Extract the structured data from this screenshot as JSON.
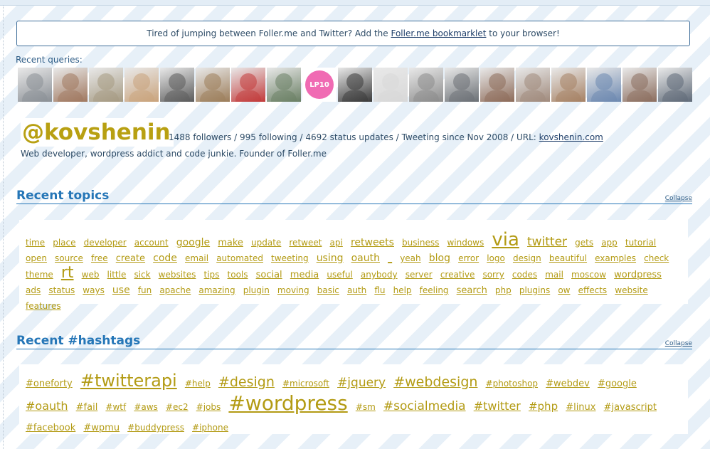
{
  "notice": {
    "before": "Tired of jumping between Foller.me and Twitter? Add the ",
    "link": "Foller.me bookmarklet",
    "after": " to your browser!"
  },
  "recent_queries_label": "Recent queries:",
  "profile": {
    "handle": "@kovshenin",
    "stats": "1488 followers / 995 following / 4692 status updates / Tweeting since Nov 2008 / URL: ",
    "url": "kovshenin.com",
    "bio": "Web developer, wordpress addict and code junkie. Founder of Foller.me"
  },
  "collapse_label": "Collapse",
  "topics_title": "Recent topics",
  "hashtags_title": "Recent #hashtags",
  "topics": [
    {
      "t": "time",
      "s": 12
    },
    {
      "t": "place",
      "s": 12
    },
    {
      "t": "developer",
      "s": 12
    },
    {
      "t": "account",
      "s": 12
    },
    {
      "t": "google",
      "s": 14
    },
    {
      "t": "make",
      "s": 13
    },
    {
      "t": "update",
      "s": 12
    },
    {
      "t": "retweet",
      "s": 12
    },
    {
      "t": "api",
      "s": 12
    },
    {
      "t": "retweets",
      "s": 14
    },
    {
      "t": "business",
      "s": 12
    },
    {
      "t": "windows",
      "s": 12
    },
    {
      "t": "via",
      "s": 26
    },
    {
      "t": "twitter",
      "s": 17
    },
    {
      "t": "gets",
      "s": 12
    },
    {
      "t": "app",
      "s": 12
    },
    {
      "t": "tutorial",
      "s": 12
    },
    {
      "t": "open",
      "s": 12
    },
    {
      "t": "source",
      "s": 12
    },
    {
      "t": "free",
      "s": 12
    },
    {
      "t": "create",
      "s": 13
    },
    {
      "t": "code",
      "s": 14
    },
    {
      "t": "email",
      "s": 12
    },
    {
      "t": "automated",
      "s": 12
    },
    {
      "t": "tweeting",
      "s": 12
    },
    {
      "t": "using",
      "s": 14
    },
    {
      "t": "oauth",
      "s": 14
    },
    {
      "t": "_",
      "s": 12
    },
    {
      "t": "yeah",
      "s": 12
    },
    {
      "t": "blog",
      "s": 14
    },
    {
      "t": "error",
      "s": 12
    },
    {
      "t": "logo",
      "s": 12
    },
    {
      "t": "design",
      "s": 12
    },
    {
      "t": "beautiful",
      "s": 12
    },
    {
      "t": "examples",
      "s": 12
    },
    {
      "t": "check",
      "s": 12
    },
    {
      "t": "theme",
      "s": 12
    },
    {
      "t": "rt",
      "s": 22
    },
    {
      "t": "web",
      "s": 12
    },
    {
      "t": "little",
      "s": 12
    },
    {
      "t": "sick",
      "s": 12
    },
    {
      "t": "websites",
      "s": 12
    },
    {
      "t": "tips",
      "s": 12
    },
    {
      "t": "tools",
      "s": 12
    },
    {
      "t": "social",
      "s": 13
    },
    {
      "t": "media",
      "s": 13
    },
    {
      "t": "useful",
      "s": 12
    },
    {
      "t": "anybody",
      "s": 12
    },
    {
      "t": "server",
      "s": 12
    },
    {
      "t": "creative",
      "s": 12
    },
    {
      "t": "sorry",
      "s": 12
    },
    {
      "t": "codes",
      "s": 12
    },
    {
      "t": "mail",
      "s": 12
    },
    {
      "t": "moscow",
      "s": 12
    },
    {
      "t": "wordpress",
      "s": 13
    },
    {
      "t": "ads",
      "s": 12
    },
    {
      "t": "status",
      "s": 12
    },
    {
      "t": "ways",
      "s": 12
    },
    {
      "t": "use",
      "s": 14
    },
    {
      "t": "fun",
      "s": 12
    },
    {
      "t": "apache",
      "s": 12
    },
    {
      "t": "amazing",
      "s": 12
    },
    {
      "t": "plugin",
      "s": 12
    },
    {
      "t": "moving",
      "s": 12
    },
    {
      "t": "basic",
      "s": 12
    },
    {
      "t": "auth",
      "s": 12
    },
    {
      "t": "flu",
      "s": 12
    },
    {
      "t": "help",
      "s": 12
    },
    {
      "t": "feeling",
      "s": 12
    },
    {
      "t": "search",
      "s": 13
    },
    {
      "t": "php",
      "s": 12
    },
    {
      "t": "plugins",
      "s": 12
    },
    {
      "t": "ow",
      "s": 12
    },
    {
      "t": "effects",
      "s": 12
    },
    {
      "t": "website",
      "s": 12
    },
    {
      "t": "features",
      "s": 12
    }
  ],
  "hashtags": [
    {
      "t": "#oneforty",
      "s": 13
    },
    {
      "t": "#twitterapi",
      "s": 24
    },
    {
      "t": "#help",
      "s": 12
    },
    {
      "t": "#design",
      "s": 19
    },
    {
      "t": "#microsoft",
      "s": 12
    },
    {
      "t": "#jquery",
      "s": 17
    },
    {
      "t": "#webdesign",
      "s": 19
    },
    {
      "t": "#photoshop",
      "s": 12
    },
    {
      "t": "#webdev",
      "s": 13
    },
    {
      "t": "#google",
      "s": 13
    },
    {
      "t": "#oauth",
      "s": 16
    },
    {
      "t": "#fail",
      "s": 13
    },
    {
      "t": "#wtf",
      "s": 12
    },
    {
      "t": "#aws",
      "s": 12
    },
    {
      "t": "#ec2",
      "s": 12
    },
    {
      "t": "#jobs",
      "s": 12
    },
    {
      "t": "#wordpress",
      "s": 28
    },
    {
      "t": "#sm",
      "s": 12
    },
    {
      "t": "#socialmedia",
      "s": 17
    },
    {
      "t": "#twitter",
      "s": 16
    },
    {
      "t": "#php",
      "s": 15
    },
    {
      "t": "#linux",
      "s": 13
    },
    {
      "t": "#javascript",
      "s": 13
    },
    {
      "t": "#facebook",
      "s": 13
    },
    {
      "t": "#wpmu",
      "s": 13
    },
    {
      "t": "#buddypress",
      "s": 12
    },
    {
      "t": "#iphone",
      "s": 12
    }
  ],
  "avatar_colors": [
    "#8a8f95",
    "#a0785f",
    "#a59a82",
    "#c9a37c",
    "#5b5b5b",
    "#9c7d5a",
    "#c23a3a",
    "#6a7f64",
    "#f06bb3",
    "#3a3a3a",
    "#d8d8d8",
    "#8c8c8c",
    "#6b7075",
    "#8d6b59",
    "#a08a7c",
    "#a68164",
    "#6c88b0",
    "#8b6d5e",
    "#5f6a78"
  ]
}
